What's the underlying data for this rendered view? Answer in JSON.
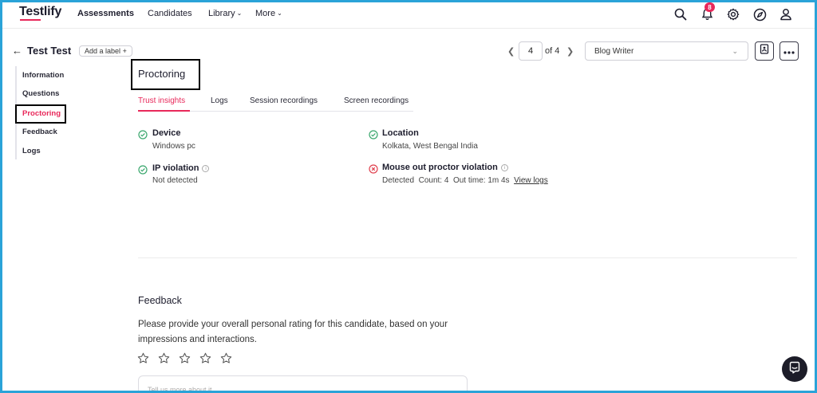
{
  "brand": {
    "name": "Testlify",
    "accent": "#e8285a"
  },
  "nav": {
    "assessments": "Assessments",
    "candidates": "Candidates",
    "library": "Library",
    "more": "More",
    "notification_count": "8"
  },
  "header": {
    "back": "←",
    "candidate_name": "Test Test",
    "add_label": "Add a label",
    "add_label_plus": "+",
    "pager_current": "4",
    "pager_of": "of 4",
    "job": "Blog Writer"
  },
  "sidebar": {
    "items": [
      {
        "label": "Information"
      },
      {
        "label": "Questions"
      },
      {
        "label": "Proctoring"
      },
      {
        "label": "Feedback"
      },
      {
        "label": "Logs"
      }
    ]
  },
  "section": {
    "title": "Proctoring"
  },
  "tabs": [
    {
      "label": "Trust insights"
    },
    {
      "label": "Logs"
    },
    {
      "label": "Session recordings"
    },
    {
      "label": "Screen recordings"
    }
  ],
  "insights": {
    "device": {
      "title": "Device",
      "value": "Windows pc",
      "status": "ok"
    },
    "location": {
      "title": "Location",
      "value": "Kolkata, West Bengal India",
      "status": "ok"
    },
    "ip": {
      "title": "IP violation",
      "value": "Not detected",
      "status": "ok"
    },
    "mouse": {
      "title": "Mouse out proctor violation",
      "detected": "Detected",
      "count": "Count: 4",
      "out_time": "Out time: 1m 4s",
      "view_logs": "View logs",
      "status": "violation"
    }
  },
  "feedback": {
    "title": "Feedback",
    "description": "Please provide your overall personal rating for this candidate, based on your impressions and interactions.",
    "rating": 0,
    "max_rating": 5,
    "placeholder": "Tell us more about it"
  },
  "colors": {
    "ok": "#3aa76d",
    "violation": "#e0414f",
    "frame": "#2aa3d8"
  }
}
